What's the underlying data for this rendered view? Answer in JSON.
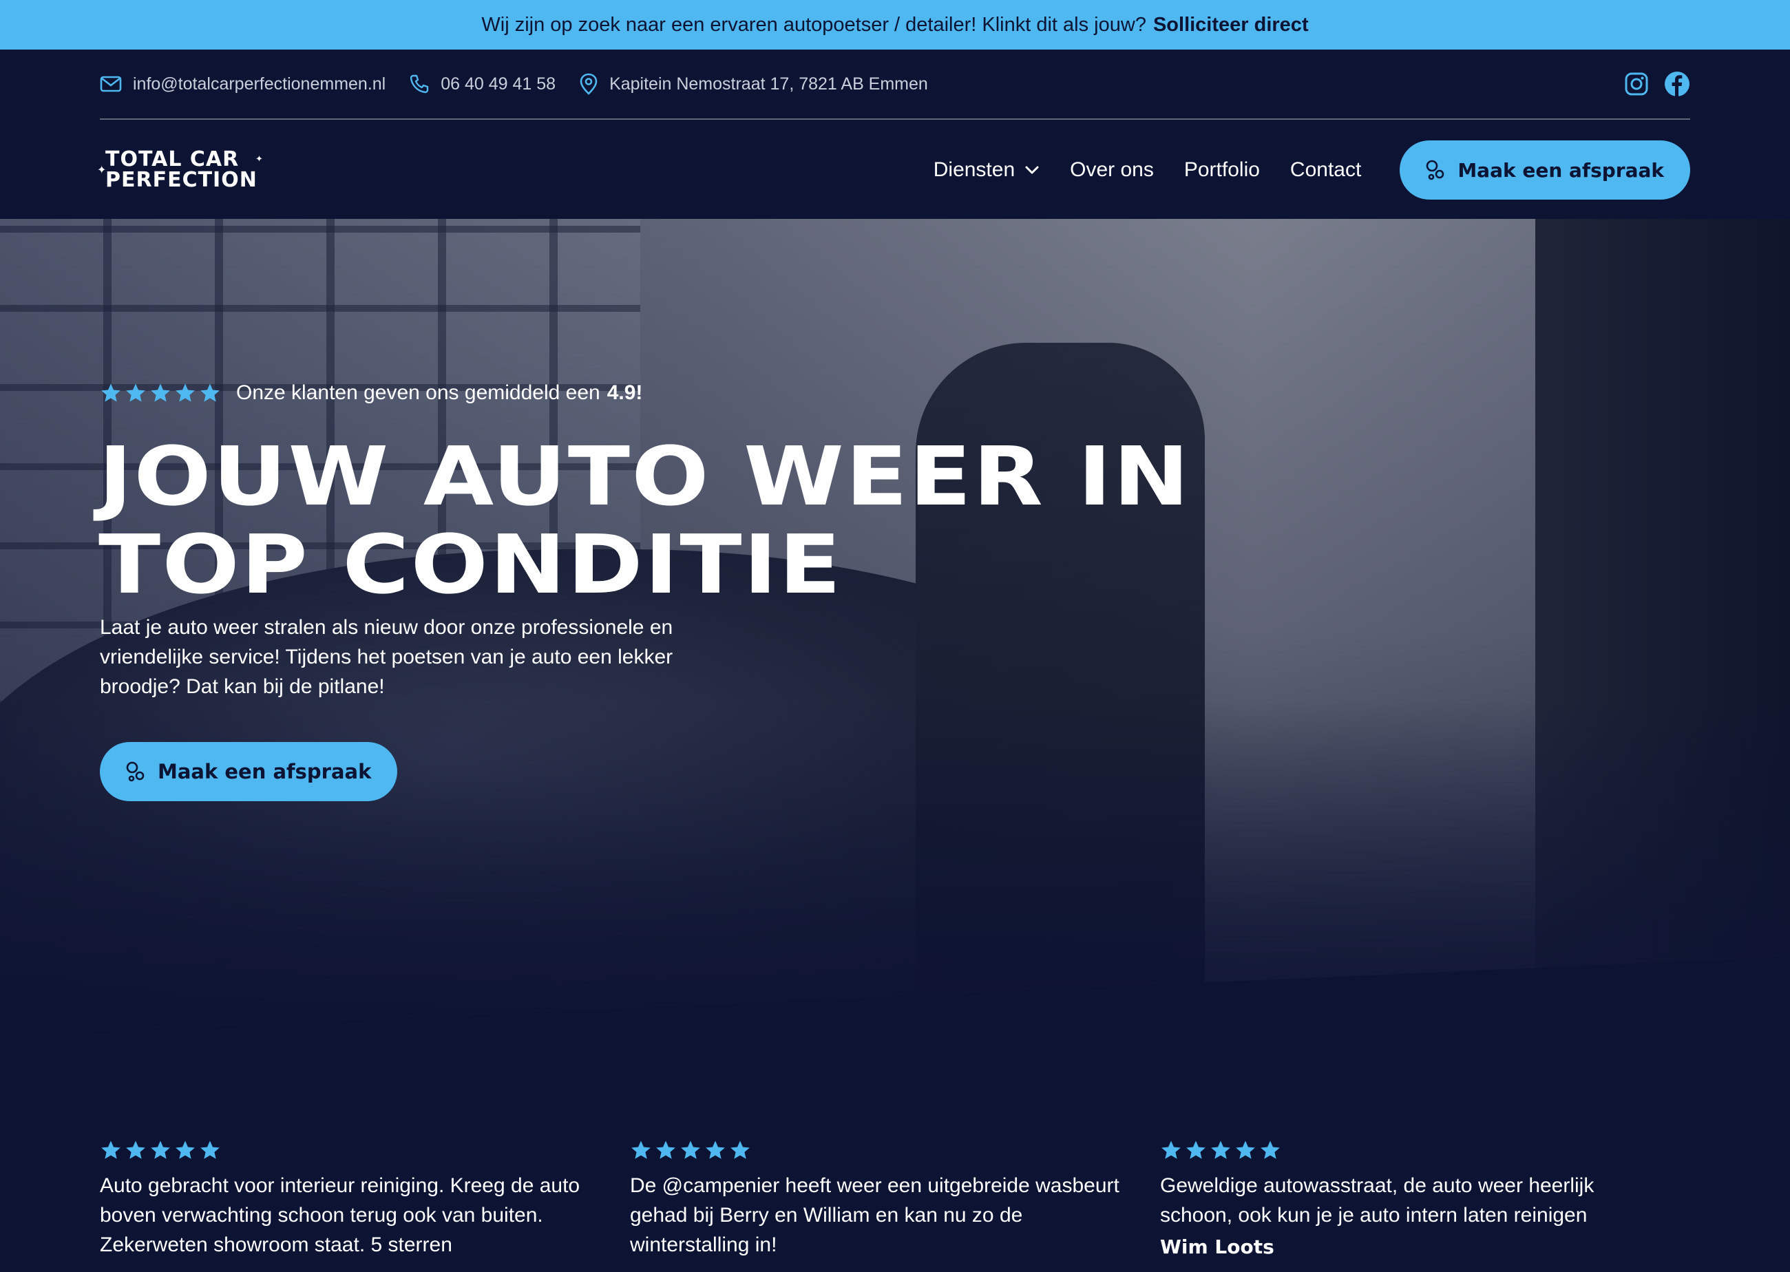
{
  "announcement": {
    "text": "Wij zijn op zoek naar een ervaren autopoetser / detailer! Klinkt dit als jouw?",
    "link": "Solliciteer direct"
  },
  "topbar": {
    "email": "info@totalcarperfectionemmen.nl",
    "phone": "06 40 49 41 58",
    "address": "Kapitein Nemostraat 17, 7821 AB Emmen",
    "socials": [
      "instagram-icon",
      "facebook-icon"
    ]
  },
  "logo": {
    "line1": "TOTAL CAR",
    "line2": "PERFECTION"
  },
  "nav": {
    "items": [
      {
        "label": "Diensten",
        "has_dropdown": true
      },
      {
        "label": "Over ons"
      },
      {
        "label": "Portfolio"
      },
      {
        "label": "Contact"
      }
    ],
    "cta": "Maak een afspraak"
  },
  "hero": {
    "rating_text": "Onze klanten geven ons gemiddeld een",
    "rating_score": "4.9!",
    "rating_stars": 5,
    "headline_line1": "JOUW AUTO WEER IN",
    "headline_line2": "TOP CONDITIE",
    "subtext": "Laat je auto weer stralen als nieuw door onze professionele en vriendelijke service! Tijdens het poetsen van je auto een lekker broodje? Dat kan bij de pitlane!",
    "cta": "Maak een afspraak"
  },
  "reviews": [
    {
      "stars": 5,
      "text": "Auto gebracht voor interieur reiniging. Kreeg de auto boven verwachting schoon terug ook van buiten. Zekerweten showroom staat. 5 sterren",
      "author": ""
    },
    {
      "stars": 5,
      "text": "De @campenier heeft weer een uitgebreide wasbeurt gehad bij Berry en William en kan nu zo de winterstalling in!",
      "author": ""
    },
    {
      "stars": 5,
      "text": "Geweldige autowasstraat,  de auto weer heerlijk schoon, ook kun je je auto intern laten reinigen",
      "author": "Wim Loots"
    }
  ],
  "colors": {
    "accent": "#4fb8f0",
    "background": "#0d1433",
    "star": "#4fb8f0"
  }
}
